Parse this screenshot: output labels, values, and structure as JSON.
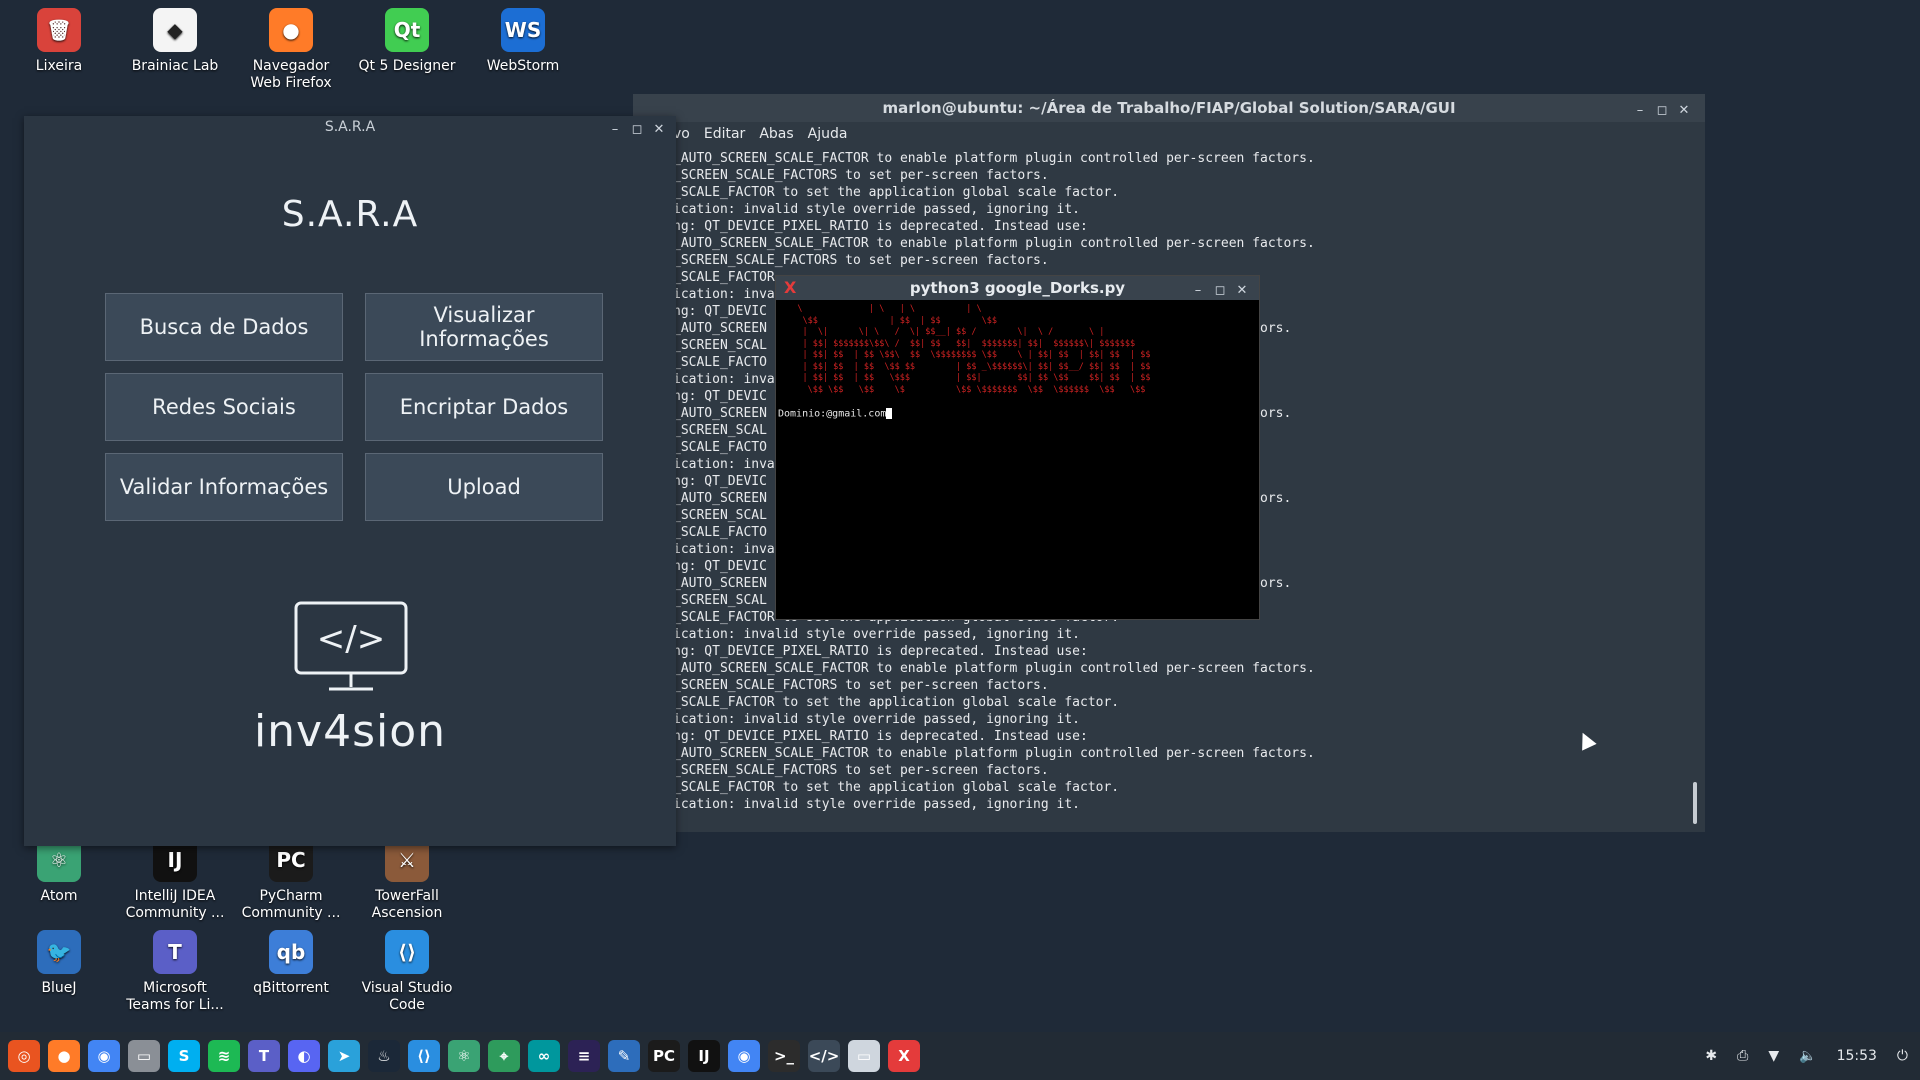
{
  "desktop_icons": [
    {
      "label": "Lixeira",
      "color": "#d9433b",
      "glyph": "🗑"
    },
    {
      "label": "Brainiac Lab",
      "color": "#f4f4f4",
      "glyph": "◆"
    },
    {
      "label": "Navegador Web Firefox",
      "color": "#ff7b28",
      "glyph": "●"
    },
    {
      "label": "Qt 5 Designer",
      "color": "#41cd52",
      "glyph": "Qt"
    },
    {
      "label": "WebStorm",
      "color": "#1c6ed4",
      "glyph": "WS"
    },
    {
      "label": "Atom",
      "color": "#3aa374",
      "glyph": "⚛"
    },
    {
      "label": "IntelliJ IDEA Community ...",
      "color": "#111111",
      "glyph": "IJ"
    },
    {
      "label": "PyCharm Community ...",
      "color": "#1b1b1b",
      "glyph": "PC"
    },
    {
      "label": "TowerFall Ascension",
      "color": "#8b5a3a",
      "glyph": "⚔"
    },
    {
      "label": "BlueJ",
      "color": "#2d6dbb",
      "glyph": "🐦"
    },
    {
      "label": "Microsoft Teams for Li...",
      "color": "#5b5fc7",
      "glyph": "T"
    },
    {
      "label": "qBittorrent",
      "color": "#3d7ed8",
      "glyph": "qb"
    },
    {
      "label": "Visual Studio Code",
      "color": "#2a8ee0",
      "glyph": "⟨⟩"
    }
  ],
  "main_terminal": {
    "title": "marlon@ubuntu: ~/Área de Trabalho/FIAP/Global Solution/SARA/GUI",
    "menu": [
      "vo",
      "Editar",
      "Abas",
      "Ajuda"
    ],
    "lines": [
      "_AUTO_SCREEN_SCALE_FACTOR to enable platform plugin controlled per-screen factors.",
      "_SCREEN_SCALE_FACTORS to set per-screen factors.",
      "_SCALE_FACTOR to set the application global scale factor.",
      "ication: invalid style override passed, ignoring it.",
      "ng: QT_DEVICE_PIXEL_RATIO is deprecated. Instead use:",
      "_AUTO_SCREEN_SCALE_FACTOR to enable platform plugin controlled per-screen factors.",
      "_SCREEN_SCALE_FACTORS to set per-screen factors.",
      "_SCALE_FACTOR",
      "ication: inva",
      "ng: QT_DEVIC",
      "_AUTO_SCREEN                                                           factors.",
      "_SCREEN_SCAL",
      "_SCALE_FACTO",
      "ication: inva",
      "ng: QT_DEVIC",
      "_AUTO_SCREEN                                                           factors.",
      "_SCREEN_SCAL",
      "_SCALE_FACTO",
      "ication: inva",
      "ng: QT_DEVIC",
      "_AUTO_SCREEN                                                           factors.",
      "_SCREEN_SCAL",
      "_SCALE_FACTO",
      "ication: inva",
      "ng: QT_DEVIC",
      "_AUTO_SCREEN                                                           factors.",
      "_SCREEN_SCAL",
      "_SCALE_FACTOR to set the application global scale factor.",
      "ication: invalid style override passed, ignoring it.",
      "ng: QT_DEVICE_PIXEL_RATIO is deprecated. Instead use:",
      "_AUTO_SCREEN_SCALE_FACTOR to enable platform plugin controlled per-screen factors.",
      "_SCREEN_SCALE_FACTORS to set per-screen factors.",
      "_SCALE_FACTOR to set the application global scale factor.",
      "ication: invalid style override passed, ignoring it.",
      "ng: QT_DEVICE_PIXEL_RATIO is deprecated. Instead use:",
      "_AUTO_SCREEN_SCALE_FACTOR to enable platform plugin controlled per-screen factors.",
      "_SCREEN_SCALE_FACTORS to set per-screen factors.",
      "_SCALE_FACTOR to set the application global scale factor.",
      "ication: invalid style override passed, ignoring it."
    ]
  },
  "sara": {
    "window_title": "S.A.R.A",
    "app_title": "S.A.R.A",
    "buttons": [
      "Busca de Dados",
      "Visualizar Informações",
      "Redes Sociais",
      "Encriptar Dados",
      "Validar Informações",
      "Upload"
    ],
    "brand": "inv4sion",
    "logo_glyph": "</>"
  },
  "dorks": {
    "title": "python3 google_Dorks.py",
    "banner": [
      "   \\             | \\   | \\          | \\",
      "    \\$$              | $$  | $$        \\$$",
      "    |  \\|      \\| \\   /  \\| $$__| $$ /        \\|  \\ /       \\ |",
      "    | $$| $$$$$$$\\$$\\ /  $$| $$   $$|  $$$$$$$| $$|  $$$$$$\\| $$$$$$$",
      "    | $$| $$  | $$ \\$$\\  $$  \\$$$$$$$$ \\$$    \\ | $$| $$  | $$| $$  | $$",
      "    | $$| $$  | $$  \\$$ $$        | $$ _\\$$$$$$\\| $$| $$__/ $$| $$  | $$",
      "    | $$| $$  | $$   \\$$$         | $$|       $$| $$ \\$$    $$| $$  | $$",
      "     \\$$ \\$$   \\$$    \\$          \\$$ \\$$$$$$$  \\$$  \\$$$$$$  \\$$   \\$$"
    ],
    "prompt": "Dominio:@gmail.com"
  },
  "taskbar": {
    "apps": [
      {
        "name": "ubuntu",
        "color": "#e95420",
        "glyph": "◎"
      },
      {
        "name": "firefox",
        "color": "#ff7b28",
        "glyph": "●"
      },
      {
        "name": "chrome",
        "color": "#4285f4",
        "glyph": "◉"
      },
      {
        "name": "files",
        "color": "#8a8f96",
        "glyph": "▭"
      },
      {
        "name": "skype",
        "color": "#00aff0",
        "glyph": "S"
      },
      {
        "name": "spotify",
        "color": "#1db954",
        "glyph": "≋"
      },
      {
        "name": "teams",
        "color": "#5b5fc7",
        "glyph": "T"
      },
      {
        "name": "discord",
        "color": "#5865f2",
        "glyph": "◐"
      },
      {
        "name": "telegram",
        "color": "#2aa1da",
        "glyph": "➤"
      },
      {
        "name": "steam",
        "color": "#1b2838",
        "glyph": "♨"
      },
      {
        "name": "vscode",
        "color": "#2a8ee0",
        "glyph": "⟨⟩"
      },
      {
        "name": "atom",
        "color": "#3aa374",
        "glyph": "⚛"
      },
      {
        "name": "maps",
        "color": "#2e9b5c",
        "glyph": "⌖"
      },
      {
        "name": "arduino",
        "color": "#00979d",
        "glyph": "∞"
      },
      {
        "name": "eclipse",
        "color": "#2c2255",
        "glyph": "≡"
      },
      {
        "name": "bluej",
        "color": "#2d6dbb",
        "glyph": "✎"
      },
      {
        "name": "pycharm",
        "color": "#1b1b1b",
        "glyph": "PC"
      },
      {
        "name": "intellij",
        "color": "#111111",
        "glyph": "IJ"
      },
      {
        "name": "chrome-window",
        "color": "#4285f4",
        "glyph": "◉"
      },
      {
        "name": "terminal",
        "color": "#2c2c2c",
        "glyph": ">_"
      },
      {
        "name": "inv4sion",
        "color": "#3b4958",
        "glyph": "</>"
      },
      {
        "name": "window",
        "color": "#cfd6de",
        "glyph": "▭"
      },
      {
        "name": "dorks",
        "color": "#e43b3b",
        "glyph": "X"
      }
    ],
    "clock": "15:53"
  }
}
